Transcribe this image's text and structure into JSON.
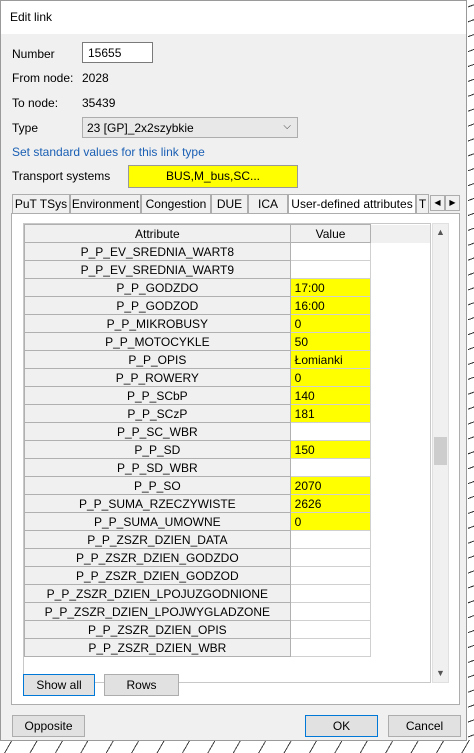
{
  "window": {
    "title": "Edit link"
  },
  "fields": {
    "number_label": "Number",
    "number_value": "15655",
    "from_label": "From node:",
    "from_value": "2028",
    "to_label": "To node:",
    "to_value": "35439",
    "type_label": "Type",
    "type_value": "23 [GP]_2x2szybkie",
    "set_standard_link": "Set standard values for this link type",
    "tsys_label": "Transport systems",
    "tsys_value": "BUS,M_bus,SC..."
  },
  "tabs": [
    "PuT TSys",
    "Environment",
    "Congestion",
    "DUE",
    "ICA",
    "User-defined attributes",
    "T"
  ],
  "active_tab": "User-defined attributes",
  "table": {
    "headers": [
      "Attribute",
      "Value"
    ],
    "rows": [
      {
        "attr": "P_P_EV_SREDNIA_WART8",
        "value": "",
        "highlight": false
      },
      {
        "attr": "P_P_EV_SREDNIA_WART9",
        "value": "",
        "highlight": false
      },
      {
        "attr": "P_P_GODZDO",
        "value": "17:00",
        "highlight": true
      },
      {
        "attr": "P_P_GODZOD",
        "value": "16:00",
        "highlight": true
      },
      {
        "attr": "P_P_MIKROBUSY",
        "value": "0",
        "highlight": true
      },
      {
        "attr": "P_P_MOTOCYKLE",
        "value": "50",
        "highlight": true
      },
      {
        "attr": "P_P_OPIS",
        "value": "Łomianki",
        "highlight": true
      },
      {
        "attr": "P_P_ROWERY",
        "value": "0",
        "highlight": true
      },
      {
        "attr": "P_P_SCbP",
        "value": "140",
        "highlight": true
      },
      {
        "attr": "P_P_SCzP",
        "value": "181",
        "highlight": true
      },
      {
        "attr": "P_P_SC_WBR",
        "value": "",
        "highlight": false
      },
      {
        "attr": "P_P_SD",
        "value": "150",
        "highlight": true
      },
      {
        "attr": "P_P_SD_WBR",
        "value": "",
        "highlight": false
      },
      {
        "attr": "P_P_SO",
        "value": "2070",
        "highlight": true
      },
      {
        "attr": "P_P_SUMA_RZECZYWISTE",
        "value": "2626",
        "highlight": true
      },
      {
        "attr": "P_P_SUMA_UMOWNE",
        "value": "0",
        "highlight": true
      },
      {
        "attr": "P_P_ZSZR_DZIEN_DATA",
        "value": "",
        "highlight": false
      },
      {
        "attr": "P_P_ZSZR_DZIEN_GODZDO",
        "value": "",
        "highlight": false
      },
      {
        "attr": "P_P_ZSZR_DZIEN_GODZOD",
        "value": "",
        "highlight": false
      },
      {
        "attr": "P_P_ZSZR_DZIEN_LPOJUZGODNIONE",
        "value": "",
        "highlight": false
      },
      {
        "attr": "P_P_ZSZR_DZIEN_LPOJWYGLADZONE",
        "value": "",
        "highlight": false
      },
      {
        "attr": "P_P_ZSZR_DZIEN_OPIS",
        "value": "",
        "highlight": false
      },
      {
        "attr": "P_P_ZSZR_DZIEN_WBR",
        "value": "",
        "highlight": false
      }
    ],
    "highlight_color": "#ffff00"
  },
  "buttons": {
    "show_all": "Show all",
    "rows": "Rows",
    "opposite": "Opposite",
    "ok": "OK",
    "cancel": "Cancel"
  },
  "icons": {
    "dropdown": "chevron-down-icon",
    "tab_left": "triangle-left-icon",
    "tab_right": "triangle-right-icon",
    "scroll_up": "scroll-up-icon",
    "scroll_down": "scroll-down-icon"
  }
}
